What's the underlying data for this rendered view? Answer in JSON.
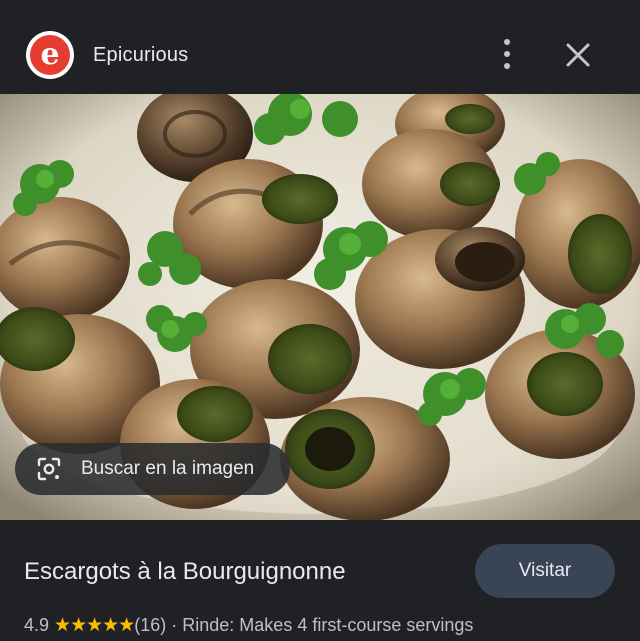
{
  "header": {
    "site_name": "Epicurious",
    "logo_letter": "e",
    "logo_color": "#e53d30",
    "menu_icon": "more-vert-icon",
    "close_icon": "close-icon"
  },
  "image": {
    "subject": "escargots-dish-image"
  },
  "lens_button": {
    "label": "Buscar en la imagen",
    "icon": "lens-icon"
  },
  "result": {
    "title": "Escargots à la Bourguignonne",
    "visit_label": "Visitar",
    "rating": "4.9",
    "stars": "★★★★★",
    "review_count": "(16)",
    "separator": "·",
    "yield": "Rinde: Makes 4 first-course servings"
  },
  "colors": {
    "background": "#202124",
    "star": "#fbbc04",
    "visit_button": "#394457"
  }
}
